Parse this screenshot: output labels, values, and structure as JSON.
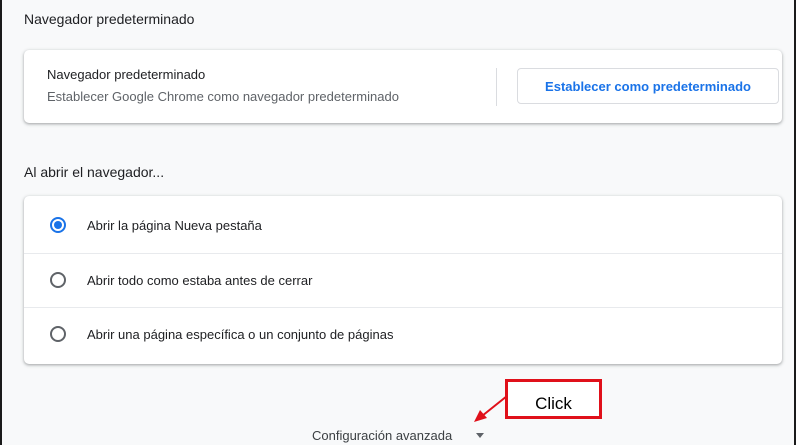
{
  "default_browser": {
    "section_title": "Navegador predeterminado",
    "card_title": "Navegador predeterminado",
    "card_description": "Establecer Google Chrome como navegador predeterminado",
    "button_label": "Establecer como predeterminado"
  },
  "on_startup": {
    "section_title": "Al abrir el navegador...",
    "options": [
      {
        "label": "Abrir la página Nueva pestaña",
        "checked": true
      },
      {
        "label": "Abrir todo como estaba antes de cerrar",
        "checked": false
      },
      {
        "label": "Abrir una página específica o un conjunto de páginas",
        "checked": false
      }
    ]
  },
  "advanced": {
    "label": "Configuración avanzada",
    "icon": "chevron-down-icon"
  },
  "annotation": {
    "callout_text": "Click",
    "color": "#e0101a"
  },
  "colors": {
    "accent": "#1a73e8",
    "text_primary": "#202124",
    "text_secondary": "#5f6368",
    "background": "#f8f9fa"
  }
}
